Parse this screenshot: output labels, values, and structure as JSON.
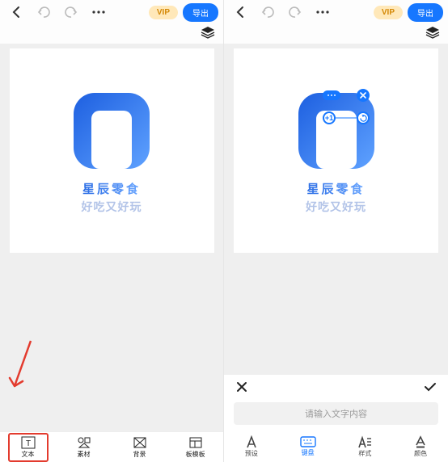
{
  "topbar": {
    "vip_label": "VIP",
    "export_label": "导出"
  },
  "canvas": {
    "brand": "星辰零食",
    "slogan": "好吃又好玩"
  },
  "left_nav": [
    {
      "label": "文本"
    },
    {
      "label": "素材"
    },
    {
      "label": "背景"
    },
    {
      "label": "板模板"
    }
  ],
  "right_panel": {
    "placeholder": "请输入文字内容"
  },
  "right_nav": [
    {
      "label": "预设"
    },
    {
      "label": "键盘"
    },
    {
      "label": "样式"
    },
    {
      "label": "颜色"
    }
  ]
}
